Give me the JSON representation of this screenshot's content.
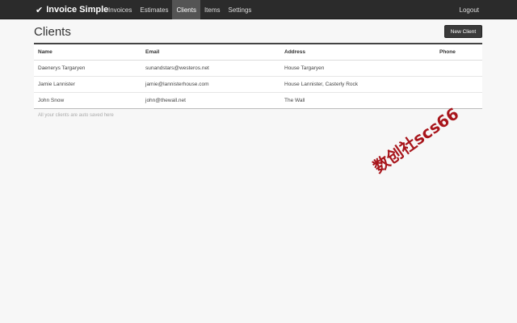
{
  "navbar": {
    "brand": "Invoice Simple",
    "brand_icon": "check-icon",
    "links": [
      "Invoices",
      "Estimates",
      "Clients",
      "Items",
      "Settings"
    ],
    "active": "Clients",
    "logout": "Logout"
  },
  "page": {
    "title": "Clients",
    "new_button": "New Client"
  },
  "table": {
    "headers": [
      "Name",
      "Email",
      "Address",
      "Phone"
    ],
    "rows": [
      [
        "Daenerys Targaryen",
        "sunandstars@westeros.net",
        "House Targaryen",
        ""
      ],
      [
        "Jamie Lannister",
        "jamie@lannisterhouse.com",
        "House Lannister, Casterly Rock",
        ""
      ],
      [
        "John Snow",
        "john@thewall.net",
        "The Wall",
        ""
      ]
    ]
  },
  "footnote": "All your clients are auto saved here",
  "watermark": "数创社scs66",
  "colors": {
    "navbar": "#2b2b2b",
    "active_tab": "#545454",
    "button": "#3a3a3a",
    "watermark": "#a8151b"
  }
}
